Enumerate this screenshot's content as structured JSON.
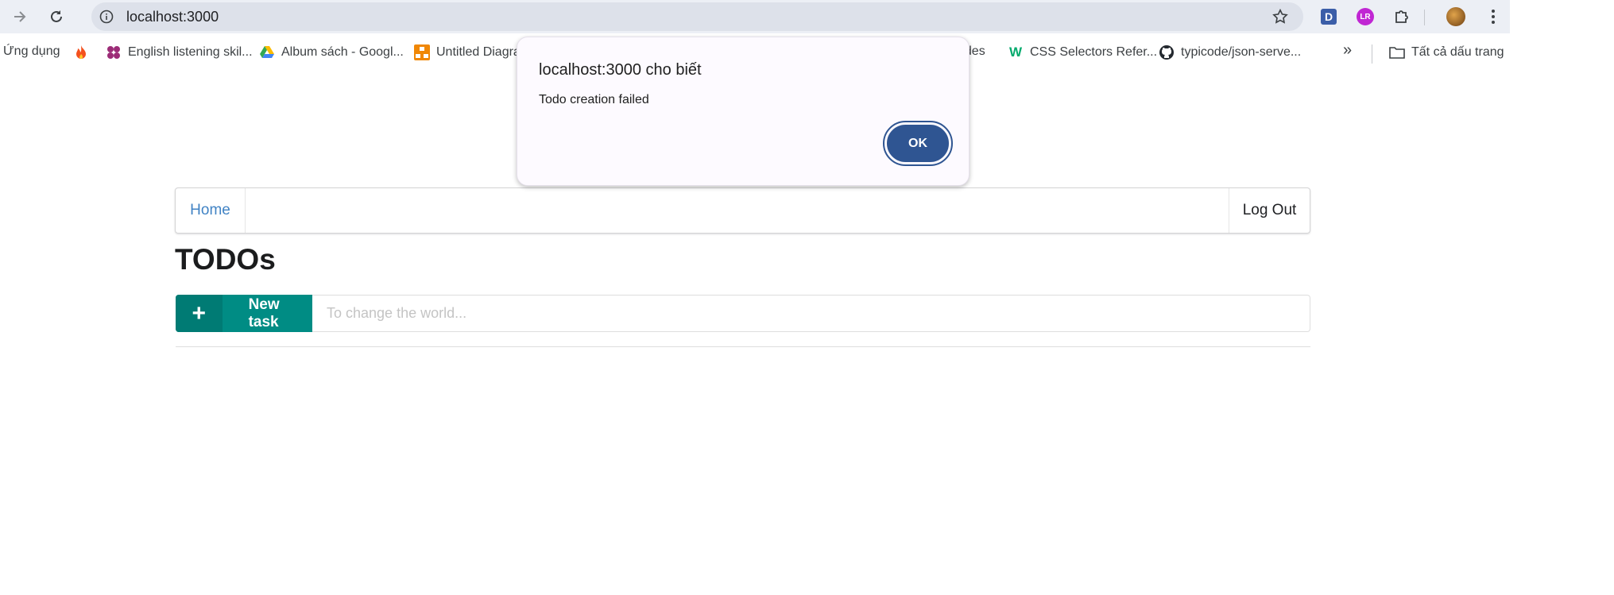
{
  "browser": {
    "url": "localhost:3000",
    "icons": [
      "arrow-forward-icon",
      "reload-icon",
      "site-info-icon",
      "star-icon",
      "extension-d-icon",
      "extension-lr-icon",
      "extensions-puzzle-icon",
      "profile-avatar",
      "menu-dots-icon"
    ]
  },
  "bookmarks": {
    "items": [
      {
        "label": "Ứng dụng",
        "icon": "apps-grid-icon"
      },
      {
        "label": "",
        "icon": "fire-icon"
      },
      {
        "label": "English listening skil...",
        "icon": "flower-icon"
      },
      {
        "label": "Album sách - Googl...",
        "icon": "google-drive-icon"
      },
      {
        "label": "Untitled Diagra",
        "icon": "diagram-icon"
      },
      {
        "label": "odes",
        "icon": ""
      },
      {
        "label": "CSS Selectors Refer...",
        "icon": "w3-icon"
      },
      {
        "label": "typicode/json-serve...",
        "icon": "github-icon"
      }
    ],
    "more_label": "»",
    "all_bookmarks": "Tất cả dấu trang"
  },
  "app": {
    "nav_home": "Home",
    "nav_logout": "Log Out",
    "title": "TODOs",
    "new_task_icon": "+",
    "new_task_label": "New task",
    "task_placeholder": "To change the world..."
  },
  "dialog": {
    "title": "localhost:3000 cho biết",
    "message": "Todo creation failed",
    "ok_label": "OK"
  },
  "colors": {
    "teal": "#008c84",
    "ok_button": "#2f5592",
    "link": "#4183c4"
  }
}
